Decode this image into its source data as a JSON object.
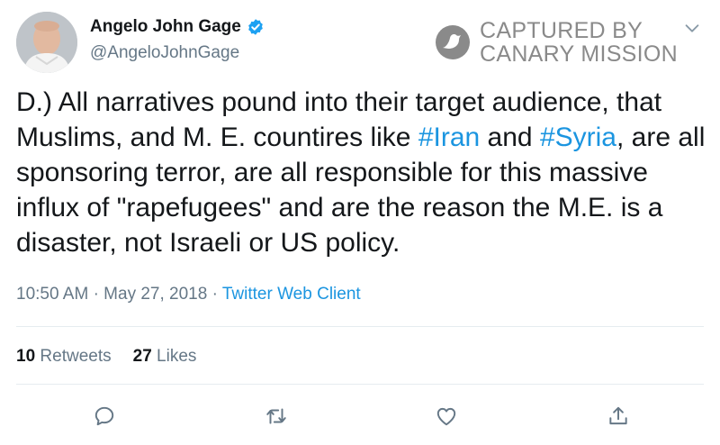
{
  "author": {
    "display_name": "Angelo John Gage",
    "handle": "@AngeloJohnGage",
    "verified": true
  },
  "watermark": {
    "line1": "CAPTURED BY",
    "line2": "CANARY MISSION"
  },
  "tweet": {
    "segments": [
      {
        "text": "D.) All narratives pound into their target audience, that Muslims, and M. E. countires like ",
        "type": "text"
      },
      {
        "text": "#Iran",
        "type": "hashtag"
      },
      {
        "text": " and ",
        "type": "text"
      },
      {
        "text": "#Syria",
        "type": "hashtag"
      },
      {
        "text": ", are all sponsoring terror, are all responsible for this massive influx of \"rapefugees\" and are the reason the M.E. is a disaster, not Israeli or US policy.",
        "type": "text"
      }
    ]
  },
  "meta": {
    "time": "10:50 AM",
    "date": "May 27, 2018",
    "separator": "·",
    "client": "Twitter Web Client"
  },
  "stats": {
    "retweets_count": "10",
    "retweets_label": "Retweets",
    "likes_count": "27",
    "likes_label": "Likes"
  },
  "icons": {
    "reply": "reply-icon",
    "retweet": "retweet-icon",
    "like": "heart-icon",
    "share": "share-icon",
    "menu": "chevron-down-icon"
  },
  "colors": {
    "text": "#14171a",
    "secondary": "#657786",
    "link": "#1b95e0",
    "verified": "#1da1f2",
    "watermark": "#8a8a8a"
  }
}
